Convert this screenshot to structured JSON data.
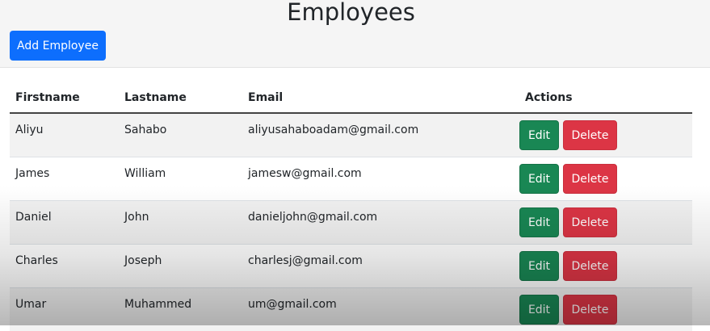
{
  "header": {
    "title": "Employees",
    "add_button_label": "Add Employee"
  },
  "table": {
    "columns": [
      "Firstname",
      "Lastname",
      "Email",
      "Actions"
    ],
    "rows": [
      {
        "firstname": "Aliyu",
        "lastname": "Sahabo",
        "email": "aliyusahaboadam@gmail.com"
      },
      {
        "firstname": "James",
        "lastname": "William",
        "email": "jamesw@gmail.com"
      },
      {
        "firstname": "Daniel",
        "lastname": "John",
        "email": "danieljohn@gmail.com"
      },
      {
        "firstname": "Charles",
        "lastname": "Joseph",
        "email": "charlesj@gmail.com"
      },
      {
        "firstname": "Umar",
        "lastname": "Muhammed",
        "email": "um@gmail.com"
      }
    ],
    "edit_label": "Edit",
    "delete_label": "Delete"
  },
  "colors": {
    "primary": "#0d6efd",
    "success": "#198754",
    "danger": "#dc3545"
  }
}
